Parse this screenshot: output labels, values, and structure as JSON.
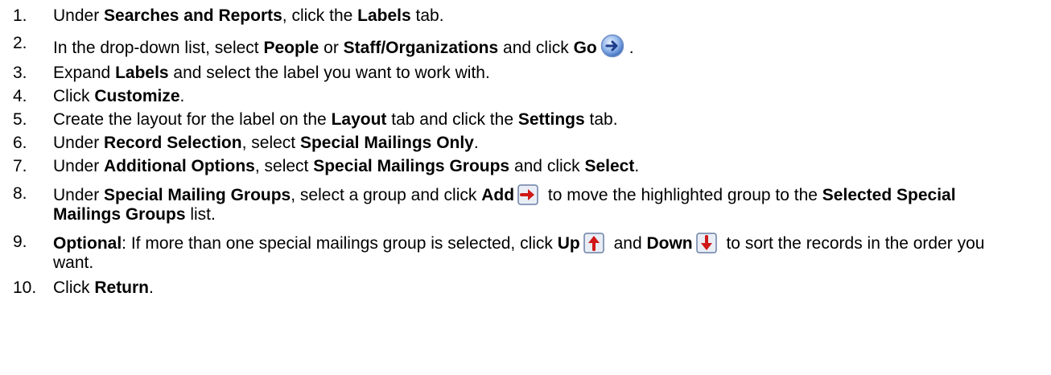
{
  "steps": [
    {
      "num": "1.",
      "parts": [
        "Under ",
        "Searches and Reports",
        ", click the ",
        "Labels",
        " tab."
      ]
    },
    {
      "num": "2.",
      "parts": [
        "In the drop-down list, select ",
        "People",
        " or ",
        "Staff/Organizations",
        " and click ",
        "Go",
        "."
      ]
    },
    {
      "num": "3.",
      "parts": [
        "Expand ",
        "Labels",
        " and select the label you want to work with."
      ]
    },
    {
      "num": "4.",
      "parts": [
        "Click ",
        "Customize",
        "."
      ]
    },
    {
      "num": "5.",
      "parts": [
        "Create the layout for the label on the ",
        "Layout",
        " tab and click the ",
        "Settings",
        " tab."
      ]
    },
    {
      "num": "6.",
      "parts": [
        "Under ",
        "Record Selection",
        ", select ",
        "Special Mailings Only",
        "."
      ]
    },
    {
      "num": "7.",
      "parts": [
        "Under ",
        "Additional Options",
        ", select ",
        "Special Mailings Groups",
        " and click ",
        "Select",
        "."
      ]
    },
    {
      "num": "8.",
      "parts": [
        "Under ",
        "Special Mailing Groups",
        ", select a group and click ",
        "Add",
        " to move the highlighted group to the ",
        "Selected Special Mailings Groups",
        " list."
      ]
    },
    {
      "num": "9.",
      "parts": [
        "Optional",
        ": If more than one special mailings group is selected, click ",
        "Up",
        " and ",
        "Down",
        " to sort the records in the order you want."
      ]
    },
    {
      "num": "10.",
      "parts": [
        "Click ",
        "Return",
        "."
      ]
    }
  ],
  "icons": {
    "go": "go-arrow-icon",
    "add": "add-arrow-icon",
    "up": "up-arrow-icon",
    "down": "down-arrow-icon"
  }
}
